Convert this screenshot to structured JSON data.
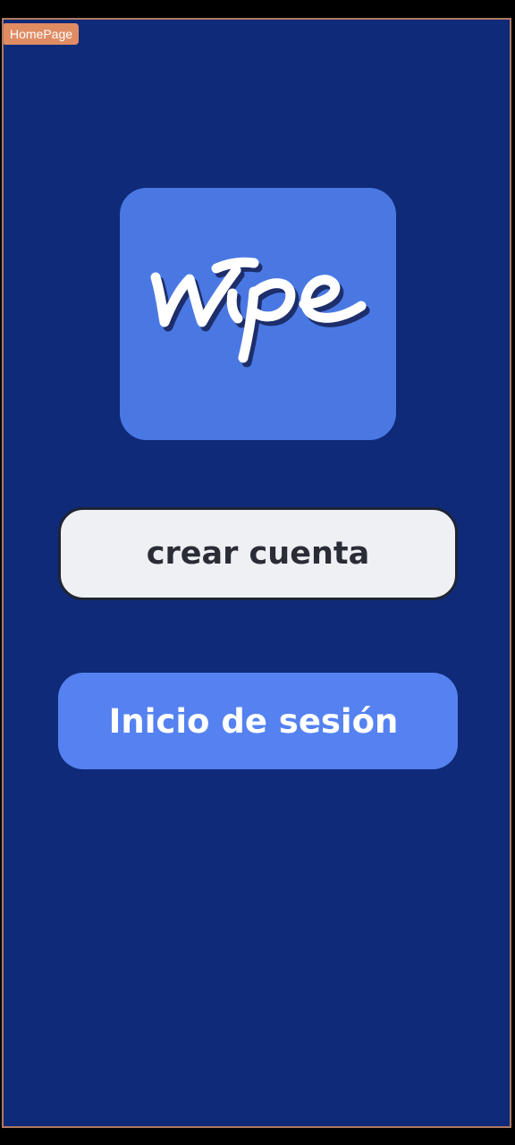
{
  "page": {
    "tag_label": "HomePage"
  },
  "logo": {
    "wordmark": "Wipe",
    "icon": "wipe-logo"
  },
  "buttons": {
    "create_account_label": "crear cuenta",
    "login_label": "Inicio de sesión"
  },
  "colors": {
    "background": "#0f2a78",
    "logo_tile": "#4a78e3",
    "create_button_bg": "#eef0f4",
    "create_button_text": "#2a2d36",
    "login_button_bg": "#5582f0",
    "login_button_text": "#ffffff",
    "frame_border": "#b07a62",
    "tag_bg": "#e08c63"
  }
}
